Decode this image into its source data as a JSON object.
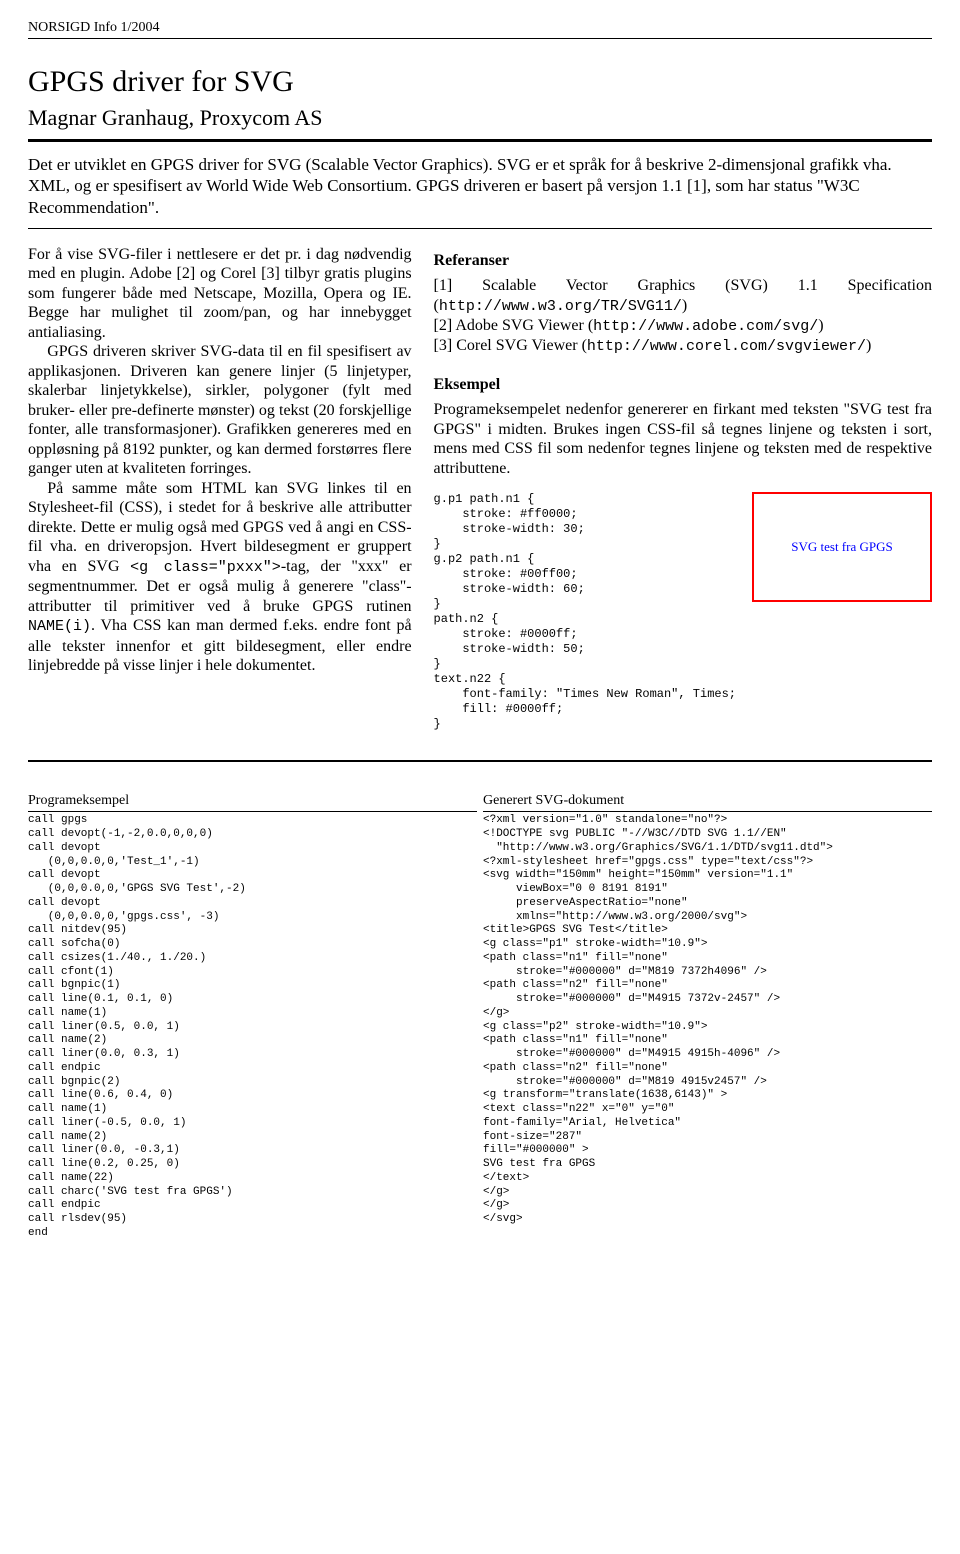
{
  "header": "NORSIGD Info 1/2004",
  "title": "GPGS driver for SVG",
  "author": "Magnar Granhaug, Proxycom AS",
  "abstract": "Det er utviklet en GPGS driver for SVG (Scalable Vector Graphics). SVG er et språk for å beskrive 2-dimensjonal grafikk vha. XML, og er spesifisert av World Wide Web Consortium. GPGS driveren er basert på versjon 1.1 [1], som har status \"W3C Recommendation\".",
  "left": {
    "p1": "For å vise SVG-filer i nettlesere er det pr. i dag nødvendig med en plugin. Adobe [2] og Corel [3] tilbyr gratis plugins som fungerer både med Netscape, Mozilla, Opera og IE. Begge har mulighet til zoom/pan, og har innebygget antialiasing.",
    "p2": "GPGS driveren skriver SVG-data til en fil spesifisert av applikasjonen. Driveren kan genere linjer (5 linjetyper, skalerbar linjetykkelse), sirkler, polygoner (fylt med bruker- eller pre-definerte mønster) og tekst (20 forskjellige fonter, alle transformasjoner). Grafikken genereres med en oppløsning på 8192 punkter, og kan dermed forstørres flere ganger uten at kvaliteten forringes.",
    "p3a": "På samme måte som HTML kan SVG linkes til en Stylesheet-fil (CSS), i stedet for å beskrive alle attributter direkte. Dette er mulig også med GPGS ved å angi en CSS-fil vha. en driveropsjon. Hvert bildesegment er gruppert vha en SVG ",
    "p3code": "<g class=\"pxxx\">",
    "p3b": "-tag, der \"xxx\" er segmentnummer. Det er også mulig å generere \"class\"-attributter til primitiver ved å bruke GPGS rutinen ",
    "p3code2": "NAME(i)",
    "p3c": ". Vha CSS kan man dermed f.eks. endre font på alle tekster innenfor et gitt bildesegment, eller endre linjebredde på visse linjer i hele dokumentet."
  },
  "right": {
    "ref_head": "Referanser",
    "ref1a": "[1] Scalable Vector Graphics (SVG) 1.1 Specification (",
    "ref1b": "http://www.w3.org/TR/SVG11/",
    "ref1c": ")",
    "ref2a": "[2] Adobe SVG Viewer (",
    "ref2b": "http://www.adobe.com/svg/",
    "ref2c": ")",
    "ref3a": "[3] Corel SVG Viewer (",
    "ref3b": "http://www.corel.com/svgviewer/",
    "ref3c": ")",
    "ex_head": "Eksempel",
    "ex_text": "Programeksempelet nedenfor genererer en firkant med teksten \"SVG test fra GPGS\" i midten. Brukes ingen CSS-fil så tegnes linjene og teksten i sort, mens med CSS fil som nedenfor tegnes linjene og teksten med de respektive attributtene.",
    "css_block": "g.p1 path.n1 {\n    stroke: #ff0000;\n    stroke-width: 30;\n}\ng.p2 path.n1 {\n    stroke: #00ff00;\n    stroke-width: 60;\n}\npath.n2 {\n    stroke: #0000ff;\n    stroke-width: 50;\n}\ntext.n22 {\n    font-family: \"Times New Roman\", Times;\n    fill: #0000ff;\n}",
    "svg_label": "SVG test fra GPGS"
  },
  "listing_left_title": "Programeksempel",
  "listing_left": "call gpgs\ncall devopt(-1,-2,0.0,0,0,0)\ncall devopt\n   (0,0,0.0,0,'Test_1',-1)\ncall devopt\n   (0,0,0.0,0,'GPGS SVG Test',-2)\ncall devopt\n   (0,0,0.0,0,'gpgs.css', -3)\ncall nitdev(95)\ncall sofcha(0)\ncall csizes(1./40., 1./20.)\ncall cfont(1)\ncall bgnpic(1)\ncall line(0.1, 0.1, 0)\ncall name(1)\ncall liner(0.5, 0.0, 1)\ncall name(2)\ncall liner(0.0, 0.3, 1)\ncall endpic\ncall bgnpic(2)\ncall line(0.6, 0.4, 0)\ncall name(1)\ncall liner(-0.5, 0.0, 1)\ncall name(2)\ncall liner(0.0, -0.3,1)\ncall line(0.2, 0.25, 0)\ncall name(22)\ncall charc('SVG test fra GPGS')\ncall endpic\ncall rlsdev(95)\nend",
  "listing_right_title": "Generert SVG-dokument",
  "listing_right": "<?xml version=\"1.0\" standalone=\"no\"?>\n<!DOCTYPE svg PUBLIC \"-//W3C//DTD SVG 1.1//EN\"\n  \"http://www.w3.org/Graphics/SVG/1.1/DTD/svg11.dtd\">\n<?xml-stylesheet href=\"gpgs.css\" type=\"text/css\"?>\n<svg width=\"150mm\" height=\"150mm\" version=\"1.1\"\n     viewBox=\"0 0 8191 8191\"\n     preserveAspectRatio=\"none\"\n     xmlns=\"http://www.w3.org/2000/svg\">\n<title>GPGS SVG Test</title>\n<g class=\"p1\" stroke-width=\"10.9\">\n<path class=\"n1\" fill=\"none\"\n     stroke=\"#000000\" d=\"M819 7372h4096\" />\n<path class=\"n2\" fill=\"none\"\n     stroke=\"#000000\" d=\"M4915 7372v-2457\" />\n</g>\n<g class=\"p2\" stroke-width=\"10.9\">\n<path class=\"n1\" fill=\"none\"\n     stroke=\"#000000\" d=\"M4915 4915h-4096\" />\n<path class=\"n2\" fill=\"none\"\n     stroke=\"#000000\" d=\"M819 4915v2457\" />\n<g transform=\"translate(1638,6143)\" >\n<text class=\"n22\" x=\"0\" y=\"0\"\nfont-family=\"Arial, Helvetica\"\nfont-size=\"287\"\nfill=\"#000000\" >\nSVG test fra GPGS\n</text>\n</g>\n</g>\n</svg>"
}
